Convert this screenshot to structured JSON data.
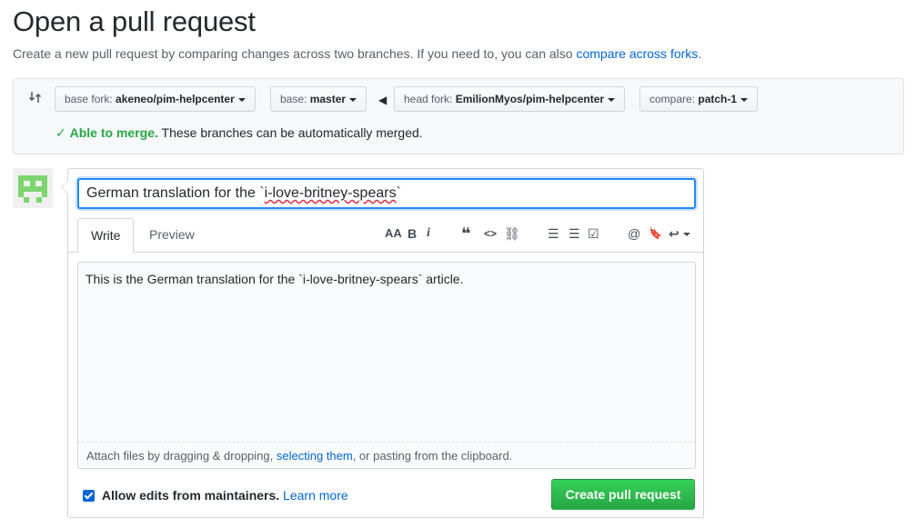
{
  "header": {
    "title": "Open a pull request",
    "subtitle": "Create a new pull request by comparing changes across two branches. If you need to, you can also",
    "subtitle_link": "compare across forks",
    "subtitle_end": "."
  },
  "range": {
    "base_fork_label": "base fork:",
    "base_fork_value": "akeneo/pim-helpcenter",
    "base_label": "base:",
    "base_value": "master",
    "arrow": "◀",
    "head_fork_label": "head fork:",
    "head_fork_value": "EmilionMyos/pim-helpcenter",
    "compare_label": "compare:",
    "compare_value": "patch-1",
    "merge_check": "✓",
    "merge_ok": "Able to merge.",
    "merge_text": "These branches can be automatically merged."
  },
  "form": {
    "title_prefix": "German translation for the `",
    "title_spell": "i-love-britney-spears",
    "title_suffix": "`",
    "tabs": [
      {
        "label": "Write"
      },
      {
        "label": "Preview"
      }
    ],
    "toolbar": [
      {
        "icon": "text-size-icon",
        "glyph": "AA"
      },
      {
        "icon": "bold-icon",
        "glyph": "B"
      },
      {
        "icon": "italic-icon",
        "glyph": "i"
      },
      {
        "icon": "quote-icon",
        "glyph": "❝"
      },
      {
        "icon": "code-icon",
        "glyph": "<>"
      },
      {
        "icon": "link-icon",
        "glyph": "⛓"
      },
      {
        "icon": "unordered-list-icon",
        "glyph": "☰"
      },
      {
        "icon": "ordered-list-icon",
        "glyph": "☰"
      },
      {
        "icon": "task-list-icon",
        "glyph": "☑"
      },
      {
        "icon": "mention-icon",
        "glyph": "@"
      },
      {
        "icon": "bookmark-icon",
        "glyph": "🔖"
      },
      {
        "icon": "reply-icon",
        "glyph": "↩"
      }
    ],
    "body": "This is the German translation for the `i-love-britney-spears` article.",
    "attach_prefix": "Attach files by dragging & dropping,",
    "attach_link": "selecting them",
    "attach_suffix": ", or pasting from the clipboard.",
    "allow_edits": "Allow edits from maintainers.",
    "learn_more": "Learn more",
    "submit": "Create pull request"
  },
  "colors": {
    "accent": "#0366d6",
    "success": "#28a745",
    "focus": "#2188ff"
  }
}
